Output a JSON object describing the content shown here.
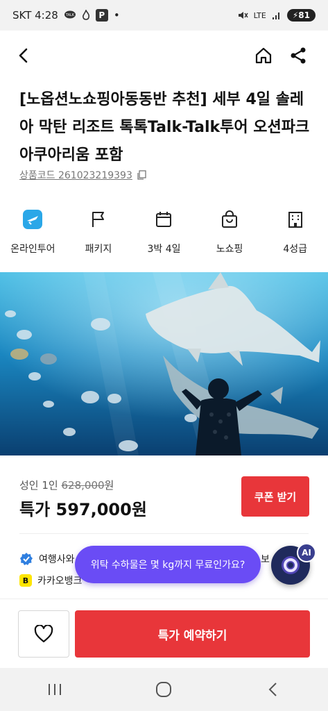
{
  "status_bar": {
    "carrier_time": "SKT 4:28",
    "talk_badge": "TALK",
    "p_badge": "P",
    "dot": "•",
    "network": "LTE",
    "battery": "81"
  },
  "header": {
    "back_icon": "back-arrow-icon",
    "home_icon": "home-icon",
    "share_icon": "share-icon"
  },
  "product": {
    "title": "[노옵션노쇼핑아동동반 추천] 세부 4일 솔레아 막탄 리조트 톡톡Talk-Talk투어 오션파크 아쿠아리움 포함",
    "code_label": "상품코드 261023219393"
  },
  "features": [
    {
      "icon": "plane-icon",
      "label": "온라인투어"
    },
    {
      "icon": "flag-icon",
      "label": "패키지"
    },
    {
      "icon": "calendar-icon",
      "label": "3박 4일"
    },
    {
      "icon": "bag-icon",
      "label": "노쇼핑"
    },
    {
      "icon": "building-icon",
      "label": "4성급"
    }
  ],
  "price": {
    "adult_label": "성인 1인",
    "original": "628,000",
    "won": "원",
    "special": "특가 597,000원",
    "coupon_button": "쿠폰 받기"
  },
  "info": {
    "row1_text": "여행사와",
    "row1_tail": "보",
    "kakao_icon": "B",
    "row2_text": "카카오뱅크 ··· ··· ···"
  },
  "ai": {
    "bubble_text": "위탁 수하물은 몇 kg까지 무료인가요?",
    "badge": "AI"
  },
  "bottom": {
    "reserve_button": "특가 예약하기"
  },
  "colors": {
    "accent_red": "#e8363a",
    "ai_purple": "#6a4cf5",
    "icon_blue": "#2aa7e8"
  }
}
